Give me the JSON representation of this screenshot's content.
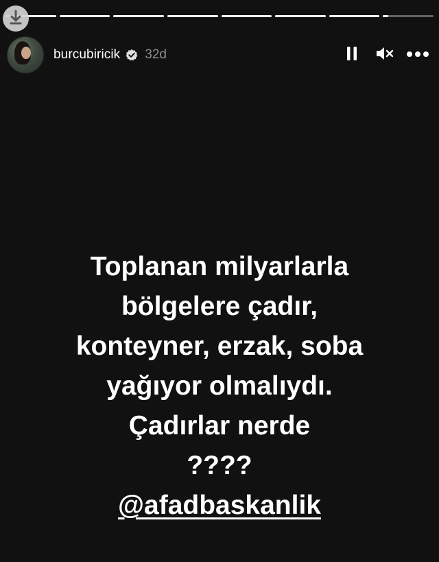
{
  "story": {
    "segments_total": 8,
    "segments_complete": 7,
    "segment_current_progress": 0.1
  },
  "header": {
    "username": "burcubiricik",
    "verified": true,
    "time": "32d",
    "icons": {
      "download": "download-icon",
      "pause": "pause-icon",
      "mute": "mute-icon",
      "more": "more-icon"
    }
  },
  "caption": {
    "lines": [
      "Toplanan milyarlarla",
      "bölgelere çadır,",
      "konteyner, erzak, soba",
      "yağıyor olmalıydı.",
      "Çadırlar nerde",
      "????"
    ],
    "mention": "@afadbaskanlik"
  },
  "colors": {
    "background": "#111111",
    "text": "#ffffff",
    "muted": "#8e8e8e"
  }
}
